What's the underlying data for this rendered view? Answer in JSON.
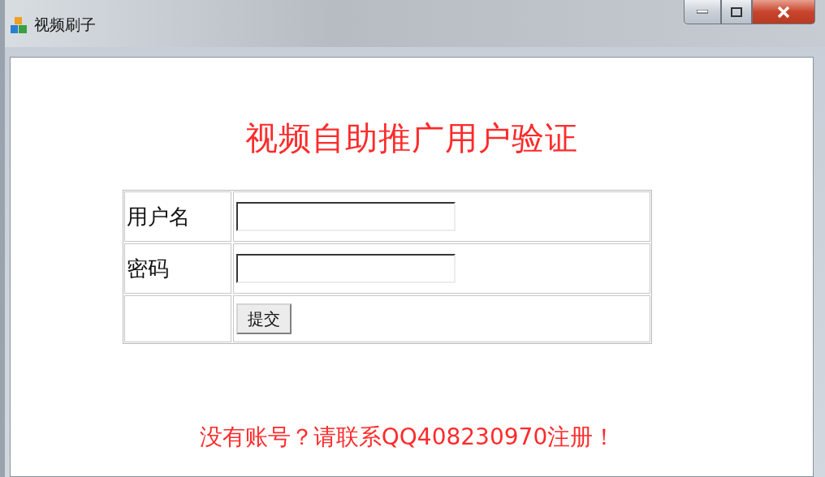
{
  "window": {
    "title": "视频刷子"
  },
  "heading": "视频自助推广用户验证",
  "form": {
    "rows": [
      {
        "label": "用户名"
      },
      {
        "label": "密码"
      }
    ],
    "submit": "提交"
  },
  "note": "没有账号？请联系QQ408230970注册！"
}
